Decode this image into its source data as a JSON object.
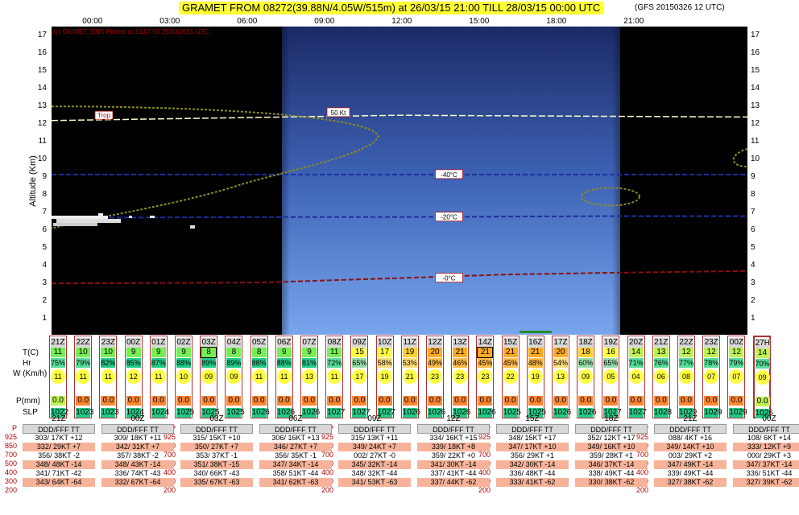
{
  "header": {
    "title": "GRAMET FROM 08272(39.88N/4.05W/515m) at 26/03/15 21:00   TILL  28/03/15 00:00 UTC",
    "subtitle": "(GFS 2015032​6 12 UTC)"
  },
  "chart_data": {
    "type": "meteogram",
    "credit": "(c) OGIMET-2015 Plotted at 21:07:50 26/03/2015 UTC",
    "ylabel": "Altitude (Km)",
    "ylim": [
      0,
      17
    ],
    "y_ticks": [
      "1",
      "2",
      "3",
      "4",
      "5",
      "6",
      "7",
      "8",
      "9",
      "10",
      "11",
      "12",
      "13",
      "14",
      "15",
      "16",
      "17"
    ],
    "time_ticks": [
      "00:00",
      "03:00",
      "06:00",
      "09:00",
      "12:00",
      "15:00",
      "18:00",
      "21:00"
    ],
    "annotations": [
      "Trop",
      "50 Kt",
      "-40°C",
      "-20°C",
      "-0°C"
    ],
    "isotherms": [
      {
        "name": "-0°C",
        "x": [
          0,
          0.3,
          0.5,
          0.65,
          0.8,
          1.0
        ],
        "y": [
          2.9,
          2.95,
          3.2,
          3.4,
          3.5,
          3.6
        ]
      },
      {
        "name": "-20°C",
        "x": [
          0,
          0.3,
          0.5,
          0.8,
          1.0
        ],
        "y": [
          6.6,
          6.65,
          6.65,
          6.7,
          6.7
        ]
      },
      {
        "name": "-40°C",
        "x": [
          0,
          0.3,
          0.5,
          0.8,
          1.0
        ],
        "y": [
          9.05,
          9.05,
          9.05,
          9.05,
          9.05
        ]
      }
    ],
    "tropopause": {
      "name": "Trop",
      "x": [
        0,
        0.5,
        1.0
      ],
      "y": [
        12.1,
        12.4,
        12.3
      ]
    },
    "jet_label": "50 Kt",
    "surface": {
      "time_labels": [
        "21Z",
        "22Z",
        "23Z",
        "00Z",
        "01Z",
        "02Z",
        "03Z",
        "04Z",
        "05Z",
        "06Z",
        "07Z",
        "08Z",
        "09Z",
        "10Z",
        "11Z",
        "12Z",
        "13Z",
        "14Z",
        "15Z",
        "16Z",
        "17Z",
        "18Z",
        "19Z",
        "20Z",
        "21Z",
        "22Z",
        "23Z",
        "00Z",
        "27H"
      ],
      "temp_c": [
        11,
        10,
        10,
        9,
        9,
        9,
        8,
        8,
        8,
        9,
        9,
        11,
        15,
        17,
        19,
        20,
        21,
        21,
        21,
        21,
        20,
        18,
        16,
        14,
        13,
        12,
        12,
        12,
        14
      ],
      "rh_pct": [
        "75%",
        "79%",
        "82%",
        "85%",
        "87%",
        "88%",
        "89%",
        "89%",
        "88%",
        "88%",
        "81%",
        "72%",
        "65%",
        "58%",
        "53%",
        "49%",
        "46%",
        "45%",
        "45%",
        "48%",
        "54%",
        "60%",
        "65%",
        "71%",
        "76%",
        "77%",
        "78%",
        "79%",
        "70%"
      ],
      "wind_kmh": [
        "11",
        "11",
        "11",
        "12",
        "11",
        "10",
        "09",
        "09",
        "11",
        "11",
        "13",
        "11",
        "17",
        "19",
        "21",
        "23",
        "23",
        "23",
        "22",
        "19",
        "13",
        "09",
        "05",
        "04",
        "06",
        "08",
        "07",
        "07",
        "09"
      ],
      "precip_mm": [
        "0.0",
        "0.0",
        "0.0",
        "0.0",
        "0.0",
        "0.0",
        "0.0",
        "0.0",
        "0.0",
        "0.0",
        "0.0",
        "0.0",
        "0.0",
        "0.0",
        "0.0",
        "0.0",
        "0.0",
        "0.0",
        "0.0",
        "0.0",
        "0.0",
        "0.0",
        "0.0",
        "0.0",
        "0.0",
        "0.0",
        "0.0",
        "0.0",
        "0.0"
      ],
      "slp_hpa": [
        "1022",
        "1023",
        "1023",
        "1024",
        "1024",
        "1025",
        "1025",
        "1025",
        "1026",
        "1026",
        "1026",
        "1027",
        "1027",
        "1027",
        "1026",
        "1026",
        "1026",
        "1026",
        "1025",
        "1025",
        "1026",
        "1026",
        "1027",
        "1027",
        "1028",
        "1029",
        "1029",
        "1029",
        "1026"
      ],
      "row_labels": [
        "T(C)",
        "Hr",
        "W (Km/h)",
        "P(mm)",
        "SLP"
      ]
    }
  },
  "soundings": {
    "levels": [
      "925",
      "850",
      "700",
      "500",
      "400",
      "300",
      "200"
    ],
    "level_prefix": "P",
    "header": "DDD/FFF TT",
    "columns": [
      {
        "time": "21Z",
        "rows": [
          "303/ 17KT +12",
          "332/ 29KT  +7",
          "356/ 38KT  -2",
          "348/ 48KT -14",
          "341/ 71KT -42",
          "343/ 64KT -64"
        ]
      },
      {
        "time": "00Z",
        "rows": [
          "309/ 18KT +11",
          "342/ 31KT  +7",
          "357/ 38KT  -2",
          "348/ 43KT -14",
          "336/ 74KT -43",
          "332/ 67KT -64"
        ]
      },
      {
        "time": "03Z",
        "rows": [
          "315/ 15KT +10",
          "350/ 27KT  +7",
          "353/ 37KT  -1",
          "351/ 38KT -15",
          "340/ 66KT -43",
          "335/ 67KT -63"
        ]
      },
      {
        "time": "06Z",
        "rows": [
          "306/ 16KT +13",
          "346/ 27KT  +7",
          "356/ 35KT  -1",
          "347/ 34KT -14",
          "358/ 51KT -44",
          "341/ 62KT -63"
        ]
      },
      {
        "time": "09Z",
        "rows": [
          "315/ 13KT +11",
          "349/ 24KT  +7",
          "002/ 27KT  -0",
          "345/ 32KT -14",
          "348/ 32KT -44",
          "341/ 53KT -63"
        ]
      },
      {
        "time": "12Z",
        "rows": [
          "334/ 16KT +15",
          "339/ 18KT  +8",
          "359/ 22KT  +0",
          "341/ 30KT -14",
          "337/ 41KT -44",
          "337/ 44KT -62"
        ]
      },
      {
        "time": "15Z",
        "rows": [
          "348/ 15KT +17",
          "347/ 17KT +10",
          "356/ 29KT  +1",
          "342/ 30KT -14",
          "336/ 48KT -44",
          "333/ 41KT -62"
        ]
      },
      {
        "time": "18Z",
        "rows": [
          "352/ 12KT +17",
          "349/ 16KT +10",
          "359/ 28KT  +1",
          "346/ 37KT -14",
          "338/ 49KT -44",
          "330/ 38KT -62"
        ]
      },
      {
        "time": "21Z",
        "rows": [
          "088/  4KT +16",
          "349/ 14KT +10",
          "003/ 29KT  +2",
          "347/ 49KT -14",
          "339/ 49KT -44",
          "327/ 38KT -62"
        ]
      },
      {
        "time": "00Z",
        "rows": [
          "108/  6KT +14",
          "333/ 12KT  +9",
          "000/ 29KT  +3",
          "347/ 37KT -14",
          "336/ 51KT -44",
          "327/ 39KT -62"
        ]
      }
    ]
  }
}
